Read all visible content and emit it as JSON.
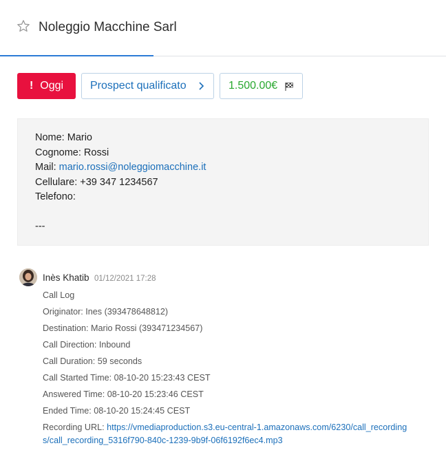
{
  "header": {
    "title": "Noleggio Macchine Sarl"
  },
  "actions": {
    "today_mark": "!",
    "today_label": "Oggi",
    "stage_label": "Prospect qualificato",
    "amount_label": "1.500.00€"
  },
  "contact": {
    "lines": {
      "nome": "Nome: Mario",
      "cognome": "Cognome: Rossi",
      "mail_prefix": "Mail:",
      "mail": "mario.rossi@noleggiomacchine.it",
      "cellulare": "Cellulare: +39 347 1234567",
      "telefono": "Telefono:",
      "separator": "---"
    }
  },
  "note": {
    "author": "Inès Khatib",
    "date": "01/12/2021 17:28",
    "lines": {
      "title": "Call Log",
      "originator": "Originator: Ines (393478648812)",
      "destination": "Destination: Mario Rossi (393471234567)",
      "direction": "Call Direction: Inbound",
      "duration": "Call Duration: 59 seconds",
      "started": "Call Started Time: 08-10-20 15:23:43 CEST",
      "answered": "Answered Time: 08-10-20 15:23:46 CEST",
      "ended": "Ended Time: 08-10-20 15:24:45 CEST",
      "recording_label": "Recording URL:",
      "recording_url": "https://vmediaproduction.s3.eu-central-1.amazonaws.com/6230/call_recordings/call_recording_5316f790-840c-1239-9b9f-06f6192f6ec4.mp3"
    }
  },
  "colors": {
    "danger": "#e8113e",
    "link": "#1b6fba",
    "success": "#29a82f",
    "tab_accent": "#2b7bd6"
  },
  "icons": {
    "favorite": "star-outline-icon",
    "stage_next": "chevron-right-icon",
    "amount": "checkered-flag-icon"
  }
}
